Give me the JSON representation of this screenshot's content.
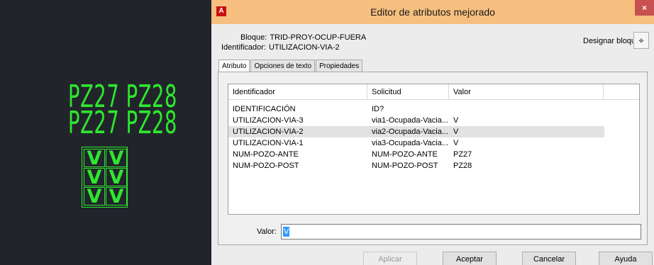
{
  "canvas": {
    "row1": "PZ27 PZ28",
    "row2": "PZ27 PZ28",
    "v_cells": [
      "V",
      "V",
      "V",
      "V",
      "V",
      "V"
    ],
    "text_color": "#2ee82e",
    "background": "#21252b"
  },
  "dialog": {
    "title": "Editor de atributos mejorado",
    "app_icon": "A",
    "close": "×",
    "bloque_label": "Bloque:",
    "bloque_value": "TRID-PROY-OCUP-FUERA",
    "identificador_label": "Identificador:",
    "identificador_value": "UTILIZACION-VIA-2",
    "designar_label": "Designar bloque",
    "tabs": [
      "Atributo",
      "Opciones de texto",
      "Propiedades"
    ],
    "columns": [
      "Identificador",
      "Solicitud",
      "Valor"
    ],
    "rows": [
      {
        "id": "IDENTIFICACIÓN",
        "solicitud": "ID?",
        "valor": ""
      },
      {
        "id": "UTILIZACION-VIA-3",
        "solicitud": "via1-Ocupada-Vacia...",
        "valor": "V"
      },
      {
        "id": "UTILIZACION-VIA-2",
        "solicitud": "via2-Ocupada-Vacia...",
        "valor": "V"
      },
      {
        "id": "UTILIZACION-VIA-1",
        "solicitud": "via3-Ocupada-Vacia...",
        "valor": "V"
      },
      {
        "id": "NUM-POZO-ANTE",
        "solicitud": "NUM-POZO-ANTE",
        "valor": "PZ27"
      },
      {
        "id": "NUM-POZO-POST",
        "solicitud": "NUM-POZO-POST",
        "valor": "PZ28"
      }
    ],
    "selected_row": 2,
    "valor_label": "Valor:",
    "valor_value": "V",
    "buttons": {
      "aplicar": "Aplicar",
      "aceptar": "Aceptar",
      "cancelar": "Cancelar",
      "ayuda": "Ayuda"
    },
    "colors": {
      "titlebar": "#f6bf7f",
      "close": "#c75050",
      "selection": "#3399ff"
    }
  }
}
